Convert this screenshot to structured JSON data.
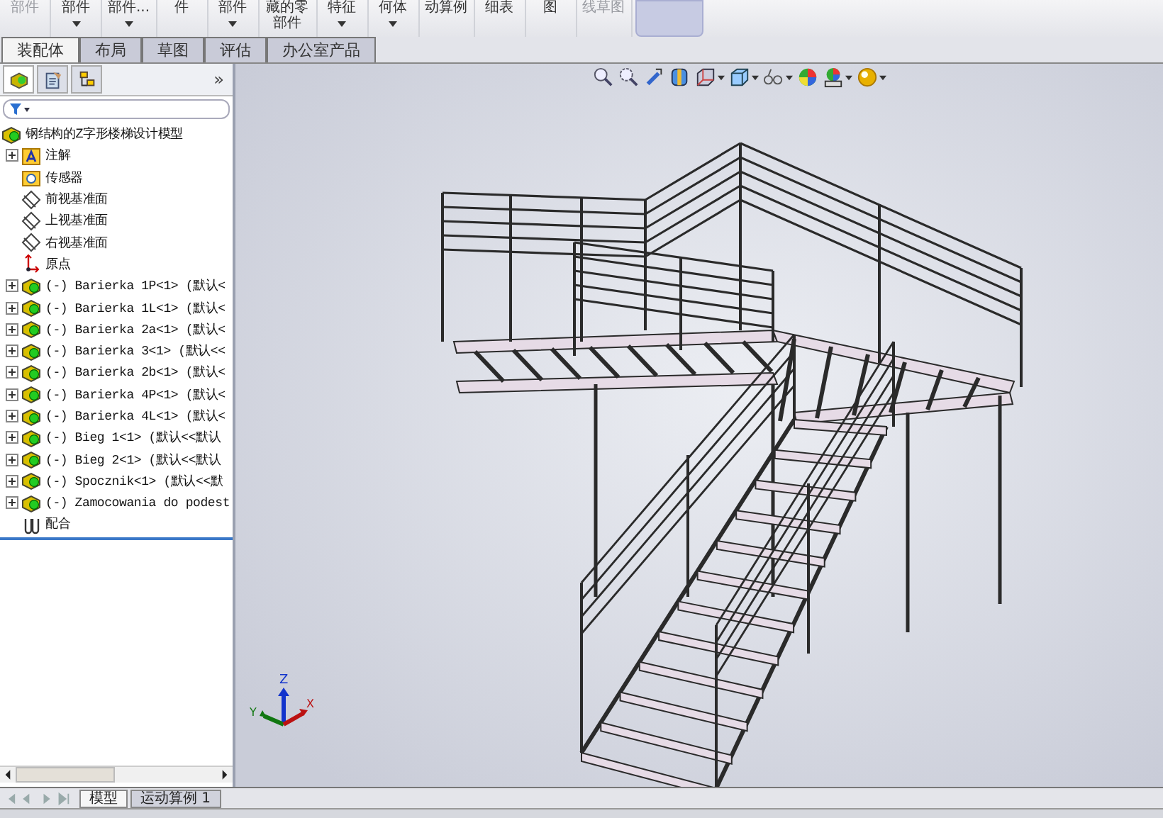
{
  "toolbar": [
    {
      "label": "部件",
      "dropdown": false,
      "disabled": true,
      "selected": false
    },
    {
      "label": "部件",
      "dropdown": true,
      "disabled": false,
      "selected": false
    },
    {
      "label": "部件...",
      "dropdown": true,
      "disabled": false,
      "selected": false
    },
    {
      "label": "件",
      "dropdown": false,
      "disabled": false,
      "selected": false
    },
    {
      "label": "部件",
      "dropdown": true,
      "disabled": false,
      "selected": false
    },
    {
      "label": "藏的零部件",
      "dropdown": false,
      "disabled": false,
      "selected": false
    },
    {
      "label": "特征",
      "dropdown": true,
      "disabled": false,
      "selected": false
    },
    {
      "label": "何体",
      "dropdown": true,
      "disabled": false,
      "selected": false
    },
    {
      "label": "动算例",
      "dropdown": false,
      "disabled": false,
      "selected": false
    },
    {
      "label": "细表",
      "dropdown": false,
      "disabled": false,
      "selected": false
    },
    {
      "label": "图",
      "dropdown": false,
      "disabled": false,
      "selected": false
    },
    {
      "label": "线草图",
      "dropdown": false,
      "disabled": true,
      "selected": false
    },
    {
      "dropdown": false,
      "disabled": false,
      "selected": true
    }
  ],
  "command_tabs": [
    {
      "label": "装配体",
      "selected": true
    },
    {
      "label": "布局",
      "selected": false
    },
    {
      "label": "草图",
      "selected": false
    },
    {
      "label": "评估",
      "selected": false
    },
    {
      "label": "办公室产品",
      "selected": false
    }
  ],
  "panel_tabs": [
    {
      "kind": "feature-tree",
      "selected": true
    },
    {
      "kind": "property",
      "selected": false
    },
    {
      "kind": "configuration",
      "selected": false
    }
  ],
  "panel_more": "»",
  "tree": {
    "root": "钢结构的Z字形楼梯设计模型",
    "children": [
      {
        "kind": "annotation",
        "label": "注解",
        "expandable": true
      },
      {
        "kind": "sensor",
        "label": "传感器",
        "expandable": false
      },
      {
        "kind": "plane",
        "label": "前视基准面",
        "expandable": false
      },
      {
        "kind": "plane",
        "label": "上视基准面",
        "expandable": false
      },
      {
        "kind": "plane",
        "label": "右视基准面",
        "expandable": false
      },
      {
        "kind": "origin",
        "label": "原点",
        "expandable": false
      },
      {
        "kind": "part",
        "label": "(-) Barierka 1P<1> (默认<",
        "expandable": true
      },
      {
        "kind": "part",
        "label": "(-) Barierka 1L<1> (默认<",
        "expandable": true
      },
      {
        "kind": "part",
        "label": "(-) Barierka 2a<1> (默认<",
        "expandable": true
      },
      {
        "kind": "part",
        "label": "(-) Barierka 3<1> (默认<<",
        "expandable": true
      },
      {
        "kind": "part",
        "label": "(-) Barierka 2b<1> (默认<",
        "expandable": true
      },
      {
        "kind": "part",
        "label": "(-) Barierka 4P<1> (默认<",
        "expandable": true
      },
      {
        "kind": "part",
        "label": "(-) Barierka 4L<1> (默认<",
        "expandable": true
      },
      {
        "kind": "part",
        "label": "(-) Bieg 1<1> (默认<<默认",
        "expandable": true
      },
      {
        "kind": "part",
        "label": "(-) Bieg 2<1> (默认<<默认",
        "expandable": true
      },
      {
        "kind": "part",
        "label": "(-) Spocznik<1> (默认<<默",
        "expandable": true
      },
      {
        "kind": "part",
        "label": "(-) Zamocowania do podest",
        "expandable": true
      },
      {
        "kind": "mate",
        "label": "配合",
        "expandable": false
      }
    ]
  },
  "view_toolbar": [
    {
      "kind": "zoom-fit",
      "dropdown": false
    },
    {
      "kind": "zoom-area",
      "dropdown": false
    },
    {
      "kind": "previous-view",
      "dropdown": false
    },
    {
      "kind": "section",
      "dropdown": false
    },
    {
      "kind": "view-orientation",
      "dropdown": true
    },
    {
      "kind": "display-style",
      "dropdown": true
    },
    {
      "kind": "hide-show",
      "dropdown": true
    },
    {
      "kind": "appearance",
      "dropdown": false
    },
    {
      "kind": "scene",
      "dropdown": true
    },
    {
      "kind": "view-settings",
      "dropdown": true
    }
  ],
  "triad": {
    "z": "Z",
    "y": "Y",
    "x": "X"
  },
  "bottom_tabs": [
    {
      "label": "模型",
      "selected": true
    },
    {
      "label": "运动算例 1",
      "selected": false
    }
  ]
}
